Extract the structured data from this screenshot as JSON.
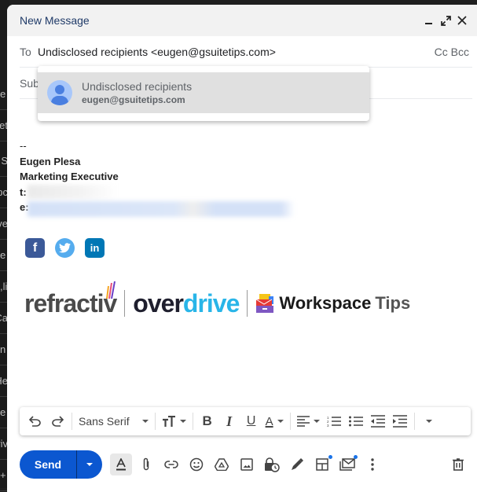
{
  "background": {
    "rows": [
      "e",
      "e",
      "et",
      "g S",
      "pc",
      "ve",
      "e",
      "li,",
      "Ca",
      "n",
      "He",
      "e",
      "riv",
      "+"
    ]
  },
  "compose": {
    "title": "New Message",
    "window_buttons": [
      "minimize-icon",
      "expand-icon",
      "close-icon"
    ],
    "to_label": "To",
    "to_value": "Undisclosed recipients <eugen@gsuitetips.com>",
    "cc_bcc": "Cc Bcc",
    "subject_placeholder": "Subject",
    "autocomplete": {
      "name": "Undisclosed recipients",
      "email": "eugen@gsuitetips.com"
    },
    "signature": {
      "separator": "--",
      "name": "Eugen Plesa",
      "title": "Marketing Executive",
      "phone_label": "t:",
      "email_label": "e:"
    },
    "social": [
      "facebook-icon",
      "twitter-icon",
      "linkedin-icon"
    ],
    "logos": {
      "refractiv": "refractiv",
      "overdrive_a": "over",
      "overdrive_b": "drive",
      "workspace_a": "Workspace",
      "workspace_b": "Tips"
    }
  },
  "format_bar": {
    "font": "Sans Serif",
    "buttons": [
      "undo",
      "redo",
      "font-family",
      "font-size",
      "bold",
      "italic",
      "underline",
      "text-color",
      "align",
      "numbered-list",
      "bulleted-list",
      "indent-less",
      "indent-more",
      "more-formatting"
    ]
  },
  "bottom_bar": {
    "send_label": "Send",
    "tools": [
      "formatting-options",
      "attach-files",
      "insert-link",
      "insert-emoji",
      "insert-drive",
      "insert-photo",
      "confidential-mode",
      "insert-signature",
      "layouts",
      "email-templates",
      "more-options"
    ],
    "accent": "#0b57d0"
  }
}
